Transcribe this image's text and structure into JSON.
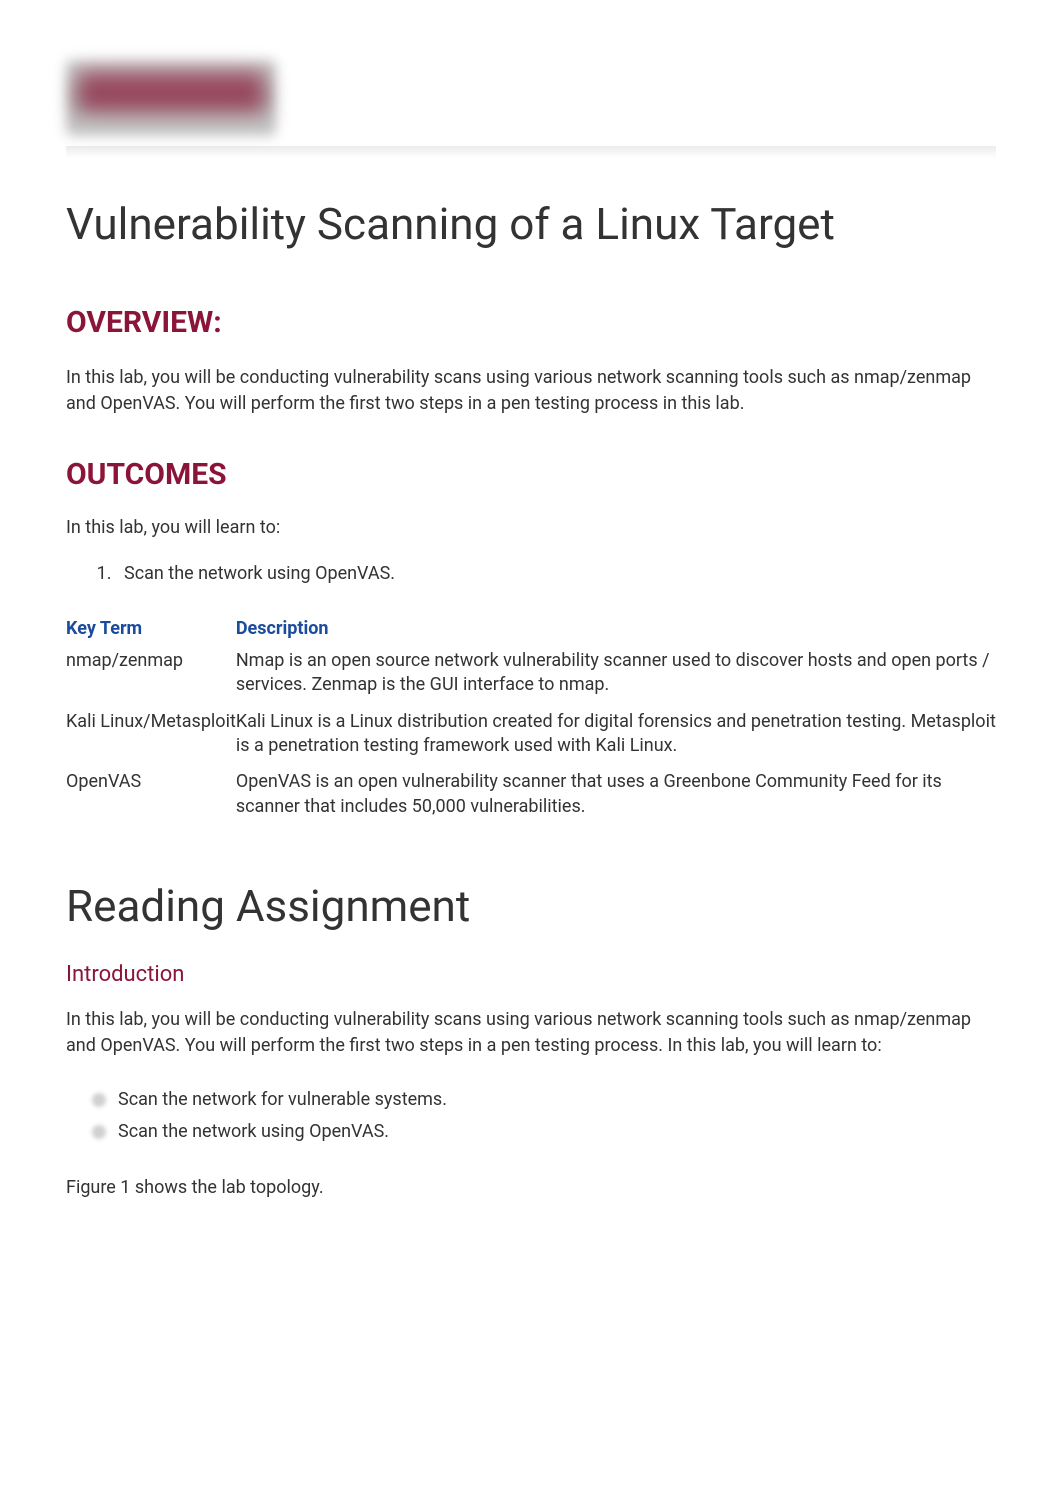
{
  "title": "Vulnerability Scanning of a Linux Target",
  "overview": {
    "heading": "OVERVIEW:",
    "text": "In this lab, you will be conducting vulnerability scans using various network scanning tools such as nmap/zenmap and OpenVAS. You will perform the first two steps in a pen testing process in this lab."
  },
  "outcomes": {
    "heading": "OUTCOMES",
    "intro": "In this lab, you will learn to:",
    "items": [
      "Scan the network using OpenVAS."
    ]
  },
  "table": {
    "headers": {
      "term": "Key Term",
      "description": "Description"
    },
    "rows": [
      {
        "term": "nmap/zenmap",
        "description": "Nmap is an open source network vulnerability scanner used to discover hosts and open ports / services. Zenmap is the GUI interface to nmap."
      },
      {
        "term": "Kali Linux/Metasploit",
        "description": "Kali Linux is a Linux distribution created for digital forensics and penetration testing. Metasploit is a penetration testing framework used with Kali Linux."
      },
      {
        "term": "OpenVAS",
        "description": "OpenVAS is an open vulnerability scanner that uses a Greenbone Community Feed for its scanner that includes 50,000 vulnerabilities."
      }
    ]
  },
  "reading": {
    "heading": "Reading Assignment",
    "intro_heading": "Introduction",
    "intro_text": "In this lab, you will be conducting vulnerability scans using various network scanning tools such as nmap/zenmap and OpenVAS. You will perform the first two steps in a pen testing process. In this lab, you will learn to:",
    "bullets": [
      "Scan the network for vulnerable systems.",
      "Scan the network using OpenVAS."
    ],
    "figure_text": "Figure 1 shows the lab topology."
  }
}
